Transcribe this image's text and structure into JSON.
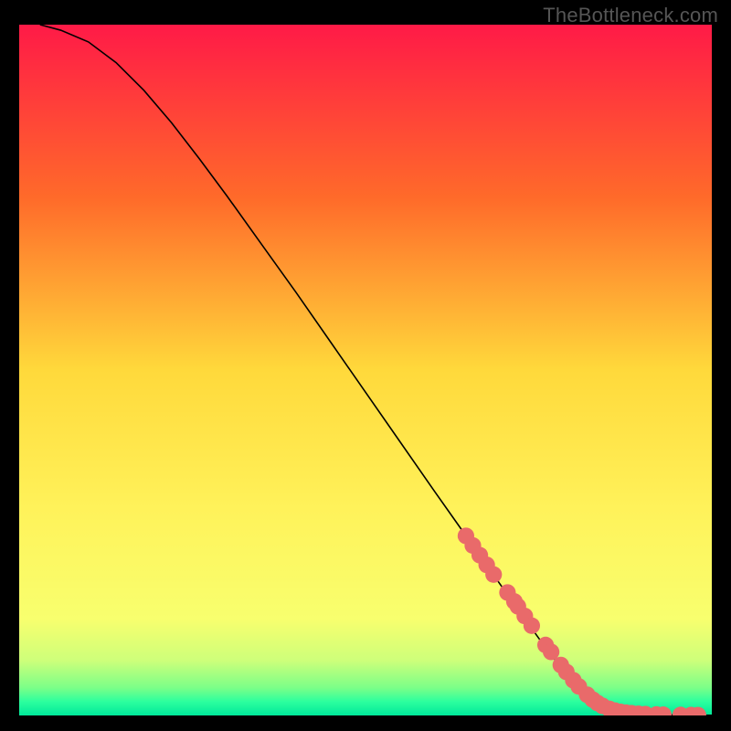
{
  "watermark": "TheBottleneck.com",
  "chart_data": {
    "type": "line",
    "title": "",
    "xlabel": "",
    "ylabel": "",
    "xlim": [
      0,
      100
    ],
    "ylim": [
      0,
      100
    ],
    "gradient_stops": [
      {
        "offset": 0,
        "color": "#ff1a47"
      },
      {
        "offset": 25,
        "color": "#ff6a2a"
      },
      {
        "offset": 50,
        "color": "#ffd93b"
      },
      {
        "offset": 70,
        "color": "#fff25a"
      },
      {
        "offset": 86,
        "color": "#f8ff6e"
      },
      {
        "offset": 92,
        "color": "#ceff7a"
      },
      {
        "offset": 96,
        "color": "#7bff88"
      },
      {
        "offset": 98,
        "color": "#2cff9e"
      },
      {
        "offset": 100,
        "color": "#00e89a"
      }
    ],
    "series": [
      {
        "name": "curve",
        "color": "#000000",
        "points": [
          {
            "x": 3,
            "y": 100
          },
          {
            "x": 6,
            "y": 99.2
          },
          {
            "x": 10,
            "y": 97.5
          },
          {
            "x": 14,
            "y": 94.5
          },
          {
            "x": 18,
            "y": 90.5
          },
          {
            "x": 22,
            "y": 85.8
          },
          {
            "x": 26,
            "y": 80.6
          },
          {
            "x": 30,
            "y": 75.2
          },
          {
            "x": 35,
            "y": 68.2
          },
          {
            "x": 40,
            "y": 61.2
          },
          {
            "x": 45,
            "y": 54.0
          },
          {
            "x": 50,
            "y": 46.8
          },
          {
            "x": 55,
            "y": 39.6
          },
          {
            "x": 60,
            "y": 32.4
          },
          {
            "x": 65,
            "y": 25.3
          },
          {
            "x": 70,
            "y": 18.2
          },
          {
            "x": 75,
            "y": 11.2
          },
          {
            "x": 78,
            "y": 7.2
          },
          {
            "x": 80,
            "y": 4.8
          },
          {
            "x": 82,
            "y": 2.9
          },
          {
            "x": 84,
            "y": 1.6
          },
          {
            "x": 86,
            "y": 0.9
          },
          {
            "x": 88,
            "y": 0.5
          },
          {
            "x": 90,
            "y": 0.28
          },
          {
            "x": 92,
            "y": 0.16
          },
          {
            "x": 94,
            "y": 0.1
          },
          {
            "x": 96,
            "y": 0.06
          },
          {
            "x": 98,
            "y": 0.04
          },
          {
            "x": 100,
            "y": 0.03
          }
        ]
      }
    ],
    "markers": {
      "color": "#e96a6a",
      "radius": 1.2,
      "points": [
        {
          "x": 64.5,
          "y": 26.0
        },
        {
          "x": 65.5,
          "y": 24.6
        },
        {
          "x": 66.5,
          "y": 23.2
        },
        {
          "x": 67.5,
          "y": 21.8
        },
        {
          "x": 68.5,
          "y": 20.4
        },
        {
          "x": 70.5,
          "y": 17.8
        },
        {
          "x": 71.5,
          "y": 16.5
        },
        {
          "x": 72.0,
          "y": 15.8
        },
        {
          "x": 73.0,
          "y": 14.4
        },
        {
          "x": 74.0,
          "y": 13.0
        },
        {
          "x": 76.0,
          "y": 10.2
        },
        {
          "x": 76.8,
          "y": 9.2
        },
        {
          "x": 78.2,
          "y": 7.3
        },
        {
          "x": 79.0,
          "y": 6.3
        },
        {
          "x": 80.0,
          "y": 5.1
        },
        {
          "x": 80.8,
          "y": 4.2
        },
        {
          "x": 82.0,
          "y": 3.0
        },
        {
          "x": 82.8,
          "y": 2.3
        },
        {
          "x": 83.5,
          "y": 1.8
        },
        {
          "x": 84.2,
          "y": 1.4
        },
        {
          "x": 85.2,
          "y": 0.95
        },
        {
          "x": 86.0,
          "y": 0.7
        },
        {
          "x": 86.8,
          "y": 0.52
        },
        {
          "x": 87.6,
          "y": 0.4
        },
        {
          "x": 88.4,
          "y": 0.32
        },
        {
          "x": 89.4,
          "y": 0.24
        },
        {
          "x": 90.4,
          "y": 0.19
        },
        {
          "x": 92.0,
          "y": 0.13
        },
        {
          "x": 93.0,
          "y": 0.1
        },
        {
          "x": 95.5,
          "y": 0.07
        },
        {
          "x": 97.0,
          "y": 0.05
        },
        {
          "x": 98.0,
          "y": 0.04
        }
      ]
    }
  }
}
